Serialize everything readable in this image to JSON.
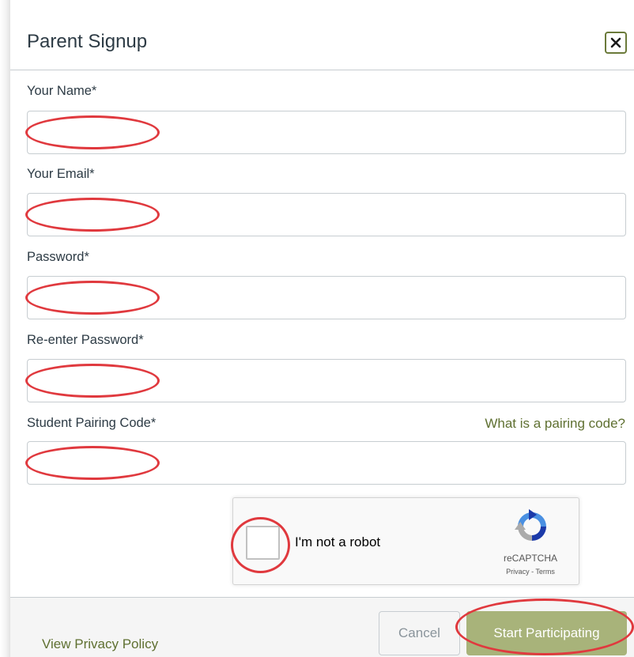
{
  "dialog": {
    "title": "Parent Signup",
    "close_icon": "close-icon"
  },
  "form": {
    "fields": [
      {
        "label": "Your Name*",
        "value": "",
        "placeholder": ""
      },
      {
        "label": "Your Email*",
        "value": "",
        "placeholder": ""
      },
      {
        "label": "Password*",
        "value": "",
        "placeholder": ""
      },
      {
        "label": "Re-enter Password*",
        "value": "",
        "placeholder": ""
      },
      {
        "label": "Student Pairing Code*",
        "value": "",
        "placeholder": ""
      }
    ],
    "pairing_help_link": "What is a pairing code?"
  },
  "captcha": {
    "checkbox_label": "I'm not a robot",
    "brand": "reCAPTCHA",
    "links": "Privacy - Terms",
    "logo_icon": "recaptcha-logo-icon"
  },
  "footer": {
    "privacy_link": "View Privacy Policy",
    "cancel_label": "Cancel",
    "submit_label": "Start Participating"
  },
  "colors": {
    "accent": "#5f7031",
    "submit_bg": "#a8b37a",
    "annotation": "#e0393e",
    "border": "#c7cdd1"
  }
}
